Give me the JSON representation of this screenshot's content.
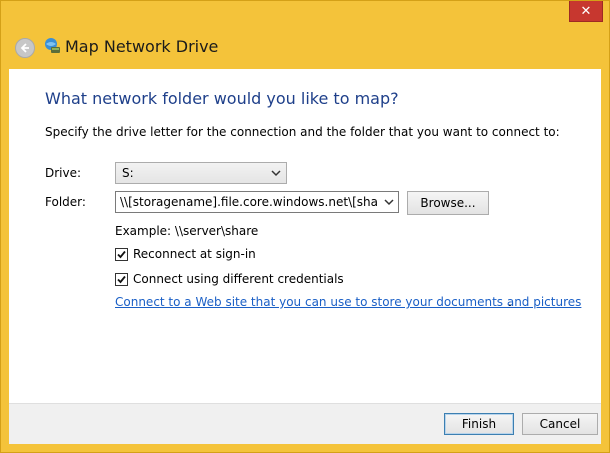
{
  "window": {
    "title": "Map Network Drive",
    "close_glyph": "✕"
  },
  "content": {
    "heading": "What network folder would you like to map?",
    "instructions": "Specify the drive letter for the connection and the folder that you want to connect to:",
    "drive_label": "Drive:",
    "drive_value": "S:",
    "folder_label": "Folder:",
    "folder_value": "\\\\[storagename].file.core.windows.net\\[sharename]",
    "browse_label": "Browse...",
    "example": "Example: \\\\server\\share",
    "reconnect_label": "Reconnect at sign-in",
    "reconnect_checked": true,
    "credentials_label": "Connect using different credentials",
    "credentials_checked": true,
    "link_text": "Connect to a Web site that you can use to store your documents and pictures",
    "link_suffix": "."
  },
  "footer": {
    "finish_label": "Finish",
    "cancel_label": "Cancel"
  },
  "icons": [
    "back-arrow-icon",
    "network-drive-icon",
    "close-icon",
    "chevron-down-icon",
    "checkmark-icon"
  ]
}
